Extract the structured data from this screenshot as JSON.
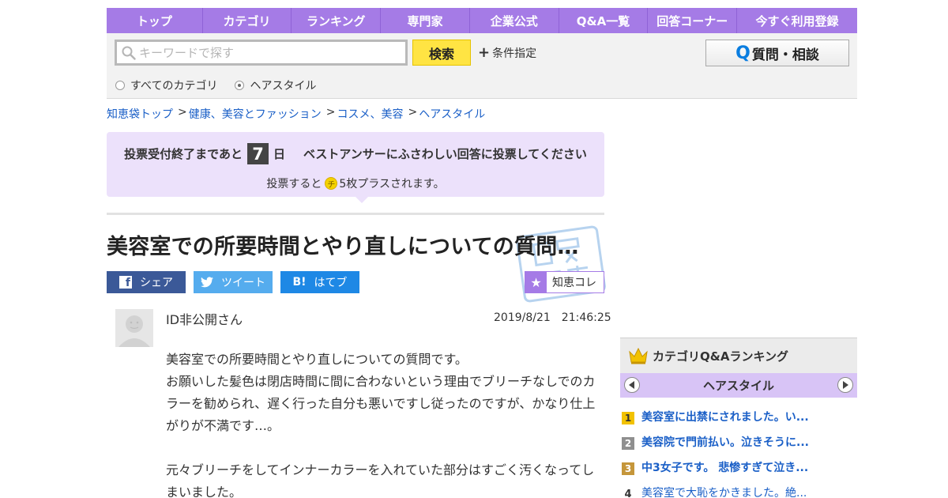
{
  "nav": [
    "トップ",
    "カテゴリ",
    "ランキング",
    "専門家",
    "企業公式",
    "Q&A一覧",
    "回答コーナー",
    "今すぐ利用登録"
  ],
  "search": {
    "placeholder": "キーワードで探す",
    "button": "検索",
    "conditions": "条件指定",
    "radio_all": "すべてのカテゴリ",
    "radio_current": "ヘアスタイル",
    "selected": "ヘアスタイル"
  },
  "ask_button": "質問・相談",
  "breadcrumb": [
    "知恵袋トップ",
    "健康、美容とファッション",
    "コスメ、美容",
    "ヘアスタイル"
  ],
  "vote": {
    "prefix": "投票受付終了まであと",
    "days": "7",
    "day_unit": "日",
    "message": "ベストアンサーにふさわしい回答に投票してください",
    "sub_prefix": "投票すると",
    "coin": "チ",
    "sub_suffix": "5枚プラスされます。"
  },
  "question": {
    "title": "美容室での所要時間とやり直しについての質問…",
    "user": "ID非公開さん",
    "date": "2019/8/21　21:46:25",
    "body": [
      "美容室での所要時間とやり直しについての質問です。\nお願いした髪色は閉店時間に間に合わないという理由でブリーチなしでのカラーを勧められ、遅く行った自分も悪いですし従ったのですが、かなり仕上がりが不満です…。",
      "元々ブリーチをしてインナーカラーを入れていた部分はすごく汚くなってしまいました。"
    ]
  },
  "share": {
    "facebook": "シェア",
    "twitter": "ツイート",
    "hatena": "はてブ",
    "hatena_icon": "B!",
    "chiekore": "知恵コレ"
  },
  "ranking": {
    "title": "カテゴリQ&Aランキング",
    "category": "ヘアスタイル",
    "items": [
      {
        "rank": "1",
        "text": "美容室に出禁にされました。い..."
      },
      {
        "rank": "2",
        "text": "美容院で門前払い。泣きそうに..."
      },
      {
        "rank": "3",
        "text": "中3女子です。 悲惨すぎて泣き..."
      },
      {
        "rank": "4",
        "text": "美容室で大恥をかきました。絶..."
      }
    ]
  },
  "colors": {
    "accent": "#a57be6",
    "vote_bg": "#ece1fb",
    "search_button": "#ffe443",
    "link": "#1a5fc7"
  }
}
